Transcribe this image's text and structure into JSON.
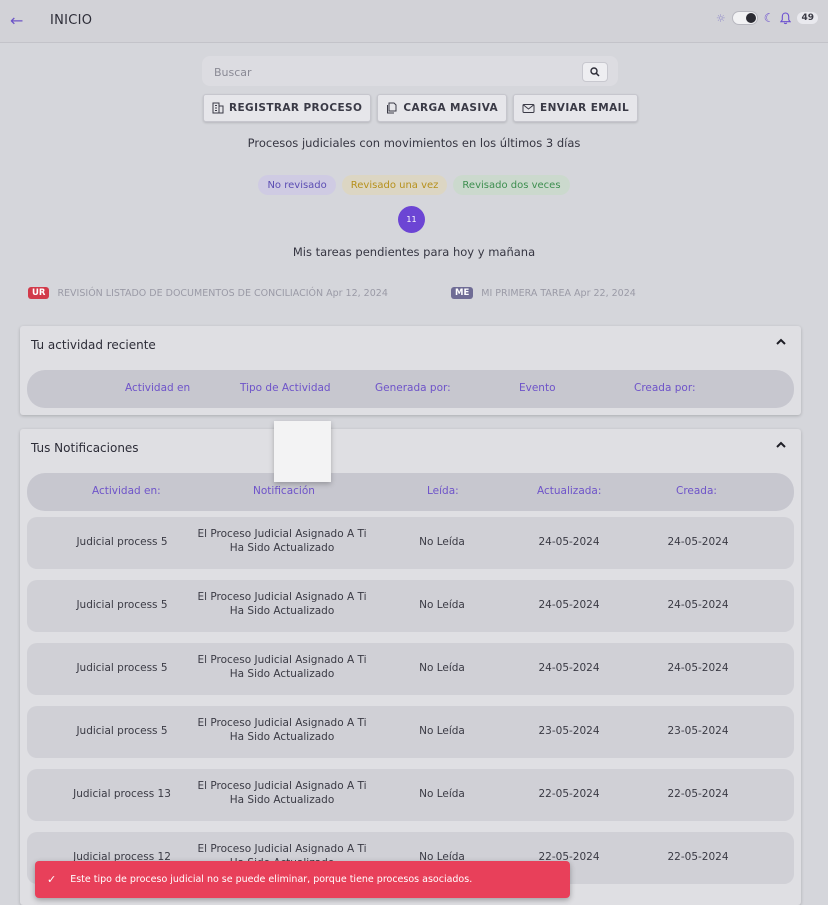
{
  "header": {
    "title": "INICIO",
    "notification_count": "49"
  },
  "search": {
    "placeholder": "Buscar"
  },
  "actions": {
    "register_label": "REGISTRAR PROCESO",
    "bulk_label": "CARGA MASIVA",
    "email_label": "ENVIAR EMAIL"
  },
  "recent_processes_title": "Procesos judiciales con movimientos en los últimos 3 días",
  "filters": {
    "not_reviewed": "No revisado",
    "reviewed_once": "Revisado una vez",
    "reviewed_twice": "Revisado dos veces"
  },
  "pending_count": "11",
  "tasks_title": "Mis tareas pendientes para hoy y mañana",
  "tasks": [
    {
      "badge": "UR",
      "text": "REVISIÓN LISTADO DE DOCUMENTOS DE CONCILIACIÓN Apr 12, 2024",
      "color": "#d23a4a"
    },
    {
      "badge": "ME",
      "text": "MI PRIMERA TAREA Apr 22, 2024",
      "color": "#6f6c95"
    }
  ],
  "activity": {
    "title": "Tu actividad reciente",
    "columns": [
      "Actividad en",
      "Tipo de Actividad",
      "Generada por:",
      "Evento",
      "Creada por:"
    ]
  },
  "notifications": {
    "title": "Tus Notificaciones",
    "columns": [
      "Actividad en:",
      "Notificación",
      "Leída:",
      "Actualizada:",
      "Creada:"
    ],
    "rows": [
      {
        "activity": "Judicial process 5",
        "notification_l1": "El Proceso Judicial Asignado A Ti",
        "notification_l2": "Ha Sido Actualizado",
        "read": "No Leída",
        "updated": "24-05-2024",
        "created": "24-05-2024"
      },
      {
        "activity": "Judicial process 5",
        "notification_l1": "El Proceso Judicial Asignado A Ti",
        "notification_l2": "Ha Sido Actualizado",
        "read": "No Leída",
        "updated": "24-05-2024",
        "created": "24-05-2024"
      },
      {
        "activity": "Judicial process 5",
        "notification_l1": "El Proceso Judicial Asignado A Ti",
        "notification_l2": "Ha Sido Actualizado",
        "read": "No Leída",
        "updated": "24-05-2024",
        "created": "24-05-2024"
      },
      {
        "activity": "Judicial process 5",
        "notification_l1": "El Proceso Judicial Asignado A Ti",
        "notification_l2": "Ha Sido Actualizado",
        "read": "No Leída",
        "updated": "23-05-2024",
        "created": "23-05-2024"
      },
      {
        "activity": "Judicial process 13",
        "notification_l1": "El Proceso Judicial Asignado A Ti",
        "notification_l2": "Ha Sido Actualizado",
        "read": "No Leída",
        "updated": "22-05-2024",
        "created": "22-05-2024"
      },
      {
        "activity": "Judicial process 12",
        "notification_l1": "El Proceso Judicial Asignado A Ti",
        "notification_l2": "Ha Sido Actualizado",
        "read": "No Leída",
        "updated": "22-05-2024",
        "created": "22-05-2024"
      }
    ]
  },
  "toast": {
    "message": "Este tipo de proceso judicial no se puede eliminar, porque tiene procesos asociados.",
    "color": "#e8405a"
  },
  "colors": {
    "accent": "#6c45d4",
    "background": "#d5d6db"
  }
}
